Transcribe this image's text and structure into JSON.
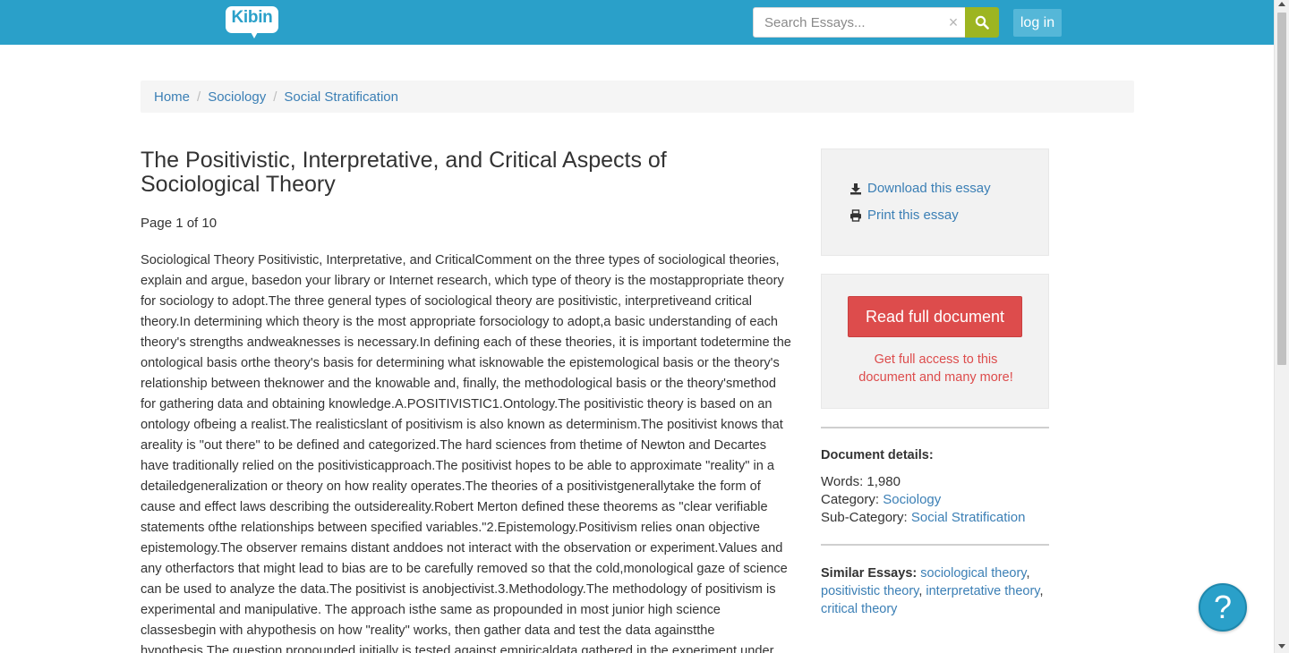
{
  "header": {
    "logo_text": "Kibin",
    "search": {
      "placeholder": "Search Essays..."
    },
    "clear_glyph": "×",
    "login_label": "log in",
    "brand_color": "#2aa0c9",
    "search_button_color": "#9db521"
  },
  "breadcrumb": {
    "items": [
      "Home",
      "Sociology",
      "Social Stratification"
    ],
    "separator": "/"
  },
  "essay": {
    "title": "The Positivistic, Interpretative, and Critical Aspects of Sociological Theory",
    "page_label": "Page 1 of 10",
    "body": "Sociological Theory Positivistic, Interpretative, and CriticalComment on the three types of sociological theories, explain and argue, basedon your library or Internet research, which type of theory is the mostappropriate theory for sociology to adopt.The three general types of sociological theory are positivistic, interpretiveand critical theory.In determining which theory is the most appropriate forsociology to adopt,a basic understanding of each theory's strengths andweaknesses is necessary.In defining each of these theories, it is important todetermine the ontological basis orthe theory's basis for determining what isknowable the epistemological basis or the theory's relationship between theknower and the knowable and, finally, the methodological basis or the theory'smethod for gathering data and obtaining knowledge.A.POSITIVISTIC1.Ontology.The positivistic theory is based on an ontology ofbeing a realist.The realisticslant of positivism is also known as determinism.The positivist knows that areality is \"out there\" to be defined and categorized.The hard sciences from thetime of Newton and Decartes have traditionally relied on the positivisticapproach.The positivist hopes to be able to approximate \"reality\" in a detailedgeneralization or theory on how reality operates.The theories of a positivistgenerallytake the form of cause and effect laws describing the outsidereality.Robert Merton defined these theorems as \"clear verifiable statements ofthe relationships between specified variables.\"2.Epistemology.Positivism relies onan objective epistemology.The observer remains distant anddoes not interact with the observation or experiment.Values and any otherfactors that might lead to bias are to be carefully removed so that the cold,monological gaze of science can be used to analyze the data.The positivist is anobjectivist.3.Methodology.The methodology of positivism is experimental and manipulative. The approach isthe same as propounded in most junior high science classesbegin with ahypothesis on how \"reality\" works, then gather data and test the data againstthe hypothesis.The question propounded initially is tested against empiricaldata gathered in the experiment under"
  },
  "sidebar": {
    "download_label": "Download this essay",
    "print_label": "Print this essay",
    "read_full_label": "Read full document",
    "access_text": "Get full access to this document and many more!",
    "accent_red": "#dd4c4c",
    "details": {
      "heading": "Document details:",
      "words_label": "Words:",
      "words_value": "1,980",
      "category_label": "Category:",
      "category_value": "Sociology",
      "subcategory_label": "Sub-Category:",
      "subcategory_value": "Social Stratification"
    },
    "similar": {
      "label": "Similar Essays:",
      "items": [
        "sociological theory",
        "positivistic theory",
        "interpretative theory",
        "critical theory"
      ]
    }
  },
  "help": {
    "glyph": "?"
  }
}
